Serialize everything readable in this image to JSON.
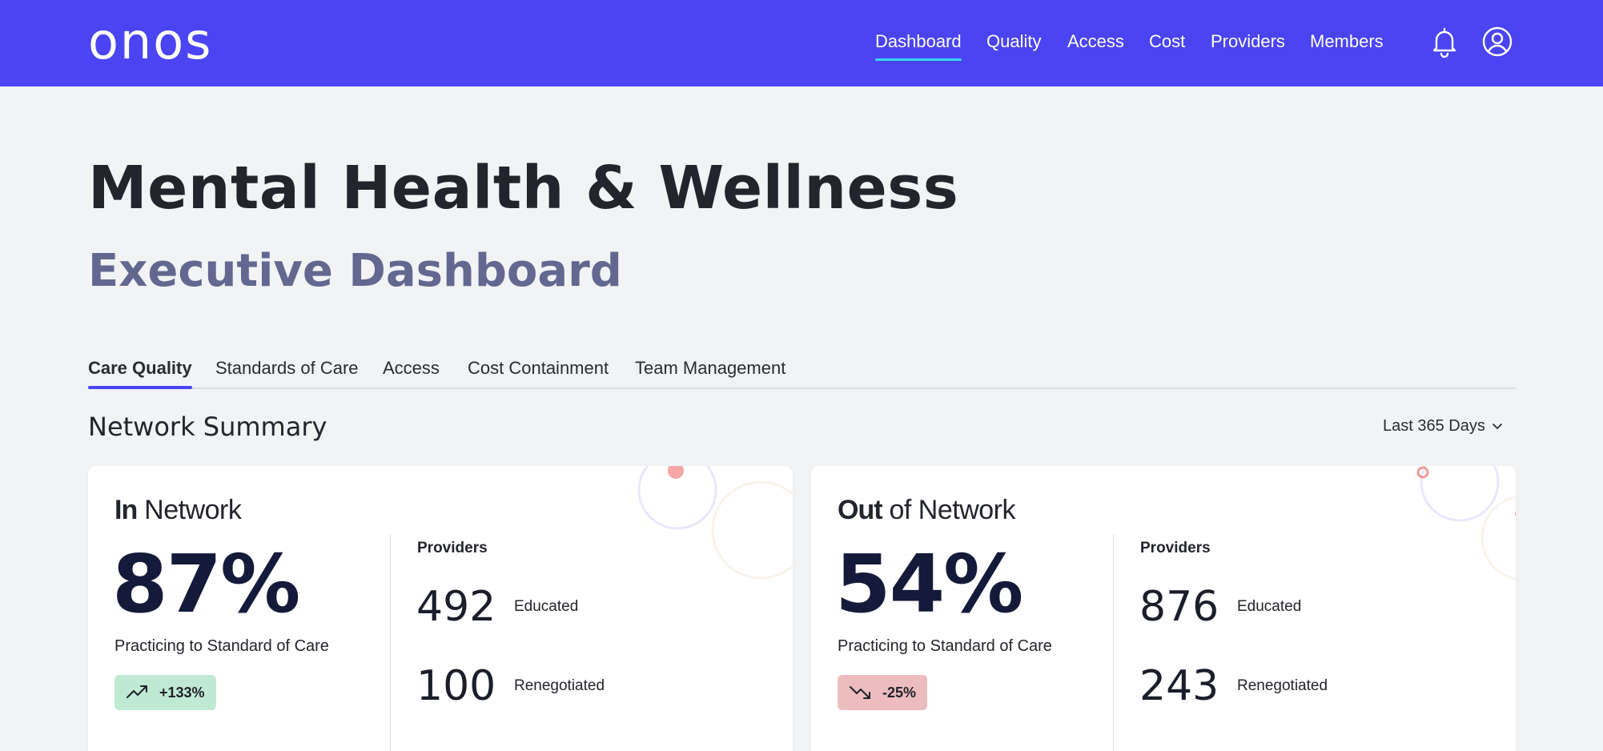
{
  "header": {
    "logo": "onos",
    "nav": [
      {
        "label": "Dashboard",
        "active": true
      },
      {
        "label": "Quality",
        "active": false
      },
      {
        "label": "Access",
        "active": false
      },
      {
        "label": "Cost",
        "active": false
      },
      {
        "label": "Providers",
        "active": false
      },
      {
        "label": "Members",
        "active": false
      }
    ],
    "icons": [
      "bell-icon",
      "user-account-icon"
    ],
    "brand_color": "#4a44f2",
    "active_underline_color": "#38d7f0"
  },
  "page": {
    "title": "Mental Health & Wellness",
    "subtitle": "Executive Dashboard"
  },
  "tabs": [
    {
      "label": "Care Quality",
      "active": true
    },
    {
      "label": "Standards of Care",
      "active": false
    },
    {
      "label": "Access",
      "active": false
    },
    {
      "label": "Cost Containment",
      "active": false
    },
    {
      "label": "Team Management",
      "active": false
    }
  ],
  "summary": {
    "title": "Network Summary",
    "range": "Last 365 Days"
  },
  "cards": [
    {
      "title_bold": "In",
      "title_rest": "Network",
      "percent": "87%",
      "caption": "Practicing to Standard of Care",
      "trend": "+133%",
      "trend_direction": "up",
      "trend_color": "#bfe9d3",
      "providers_label": "Providers",
      "providers": [
        {
          "value": "492",
          "label": "Educated"
        },
        {
          "value": "100",
          "label": "Renegotiated"
        }
      ]
    },
    {
      "title_bold": "Out",
      "title_rest": "of Network",
      "percent": "54%",
      "caption": "Practicing to Standard of Care",
      "trend": "-25%",
      "trend_direction": "down",
      "trend_color": "#ecbcbe",
      "providers_label": "Providers",
      "providers": [
        {
          "value": "876",
          "label": "Educated"
        },
        {
          "value": "243",
          "label": "Renegotiated"
        }
      ]
    }
  ]
}
